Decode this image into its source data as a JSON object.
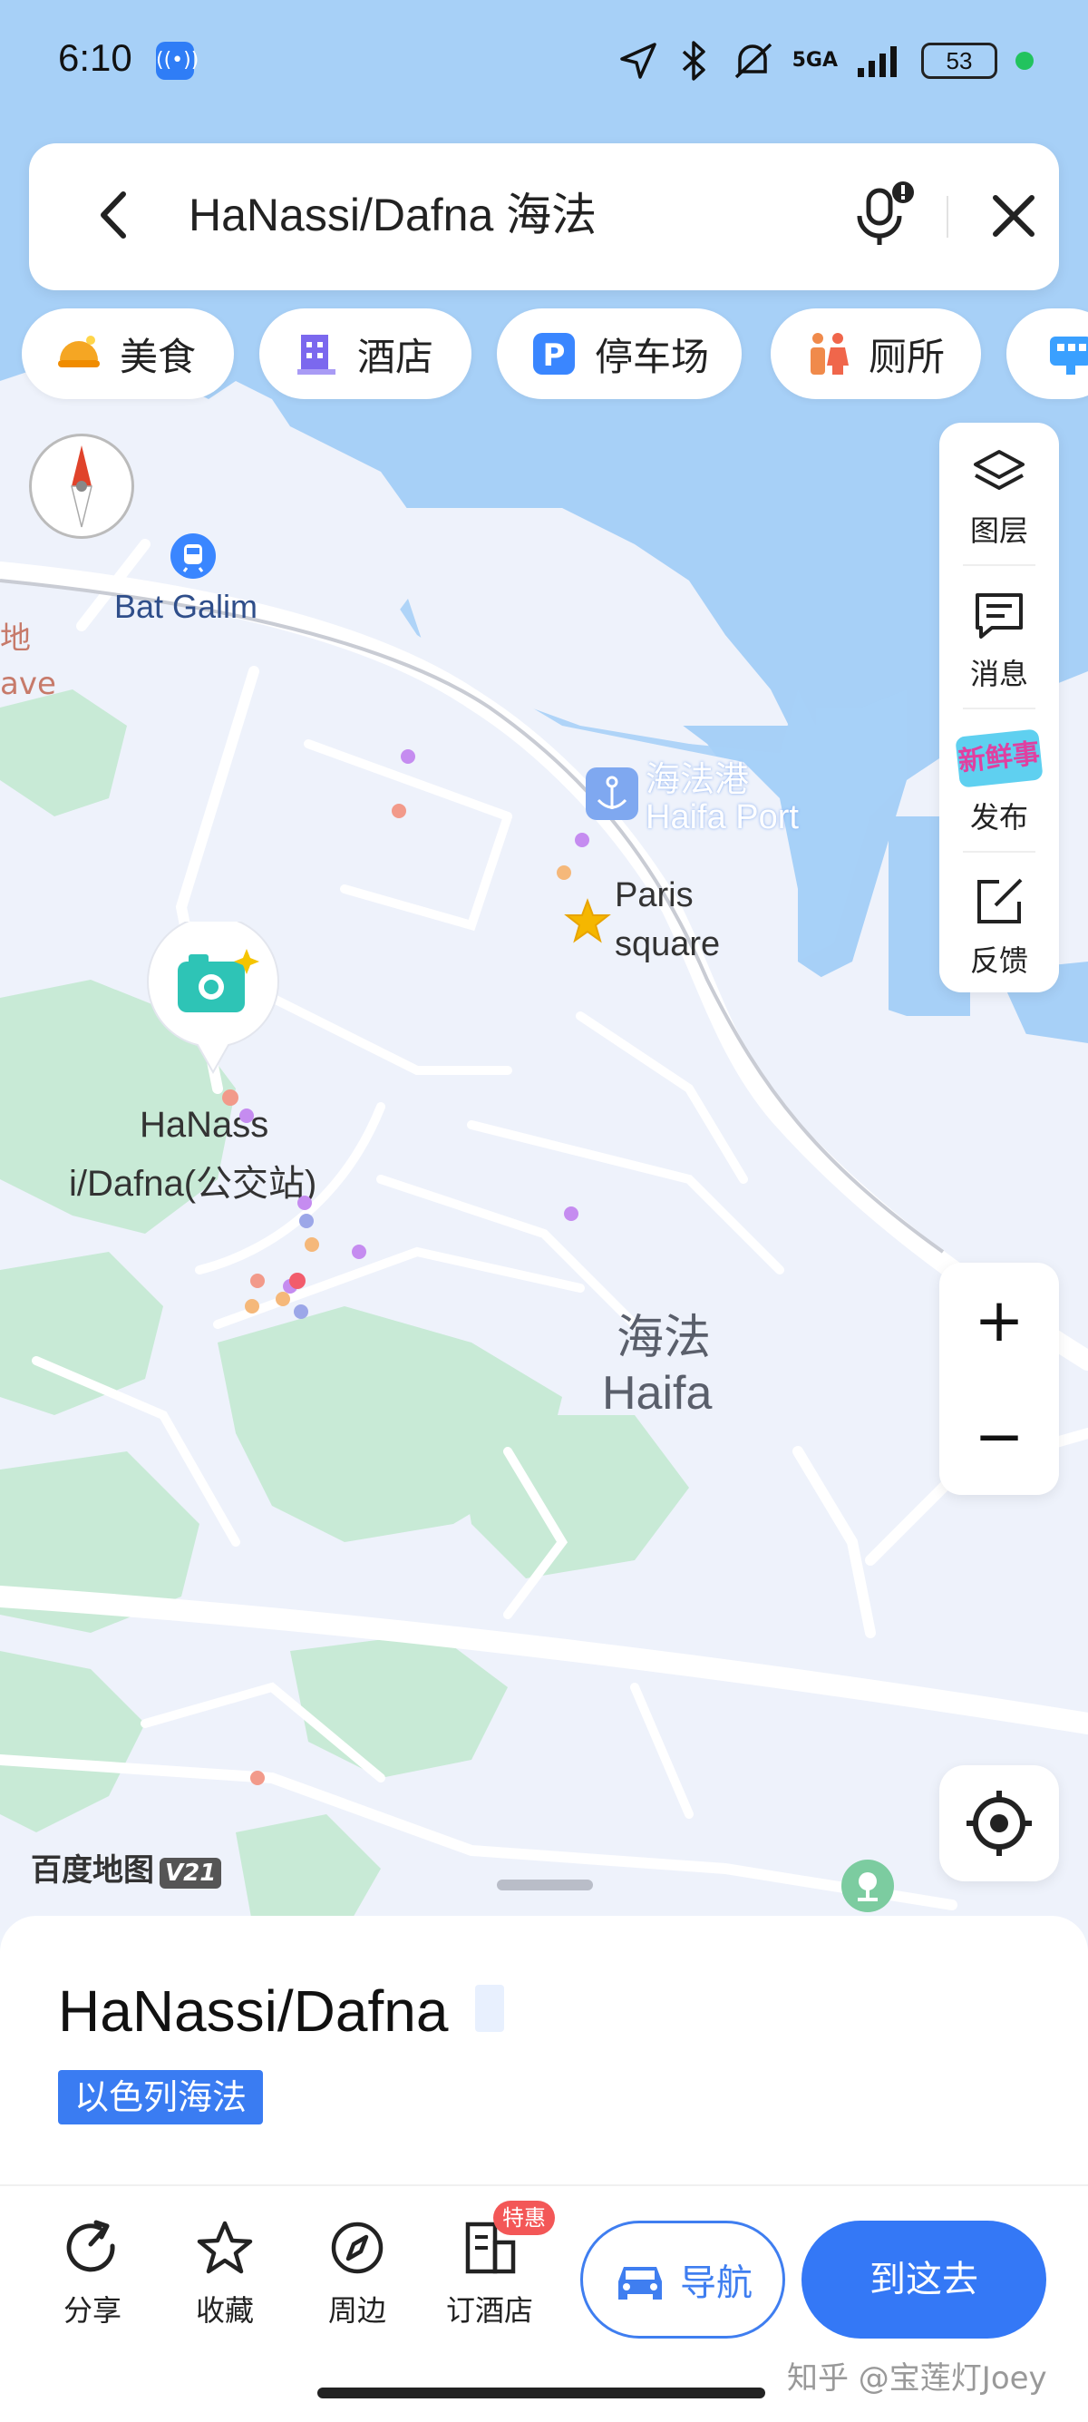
{
  "status_bar": {
    "time": "6:10",
    "network": "5GA",
    "battery": "53"
  },
  "search": {
    "query": "HaNassi/Dafna 海法"
  },
  "categories": [
    {
      "label": "美食",
      "icon": "food-icon",
      "color": "#f5a623"
    },
    {
      "label": "酒店",
      "icon": "hotel-icon",
      "color": "#7b68ee"
    },
    {
      "label": "停车场",
      "icon": "parking-icon",
      "color": "#3a86ff"
    },
    {
      "label": "厕所",
      "icon": "toilet-icon",
      "color": "#f08a4b"
    }
  ],
  "toolbar": {
    "layers": "图层",
    "messages": "消息",
    "publish": "发布",
    "publish_badge": "新鲜事",
    "feedback": "反馈"
  },
  "map_labels": {
    "bat_galim": "Bat Galim",
    "port_cn": "海法港",
    "port_en": "Haifa Port",
    "paris_1": "Paris",
    "paris_2": "square",
    "bus_stop_1": "HaNass",
    "bus_stop_2": "i/Dafna(公交站)",
    "city_cn": "海法",
    "city_en": "Haifa",
    "edge_1": "地",
    "edge_2": "ave"
  },
  "zoom": {
    "in": "+",
    "out": "−"
  },
  "baidu_logo": "百度地图",
  "baidu_version": "V21",
  "poi": {
    "name": "HaNassi/Dafna",
    "region": "以色列海法"
  },
  "bottom_actions": {
    "share": "分享",
    "favorite": "收藏",
    "nearby": "周边",
    "book_hotel": "订酒店",
    "deal_badge": "特惠",
    "navigate": "导航",
    "go_here": "到这去"
  },
  "watermark": "知乎 @宝莲灯Joey",
  "colors": {
    "accent": "#3478f6",
    "water": "#a7d0f7",
    "land": "#eef2fb",
    "park": "#c8ead6",
    "road": "#ffffff"
  }
}
